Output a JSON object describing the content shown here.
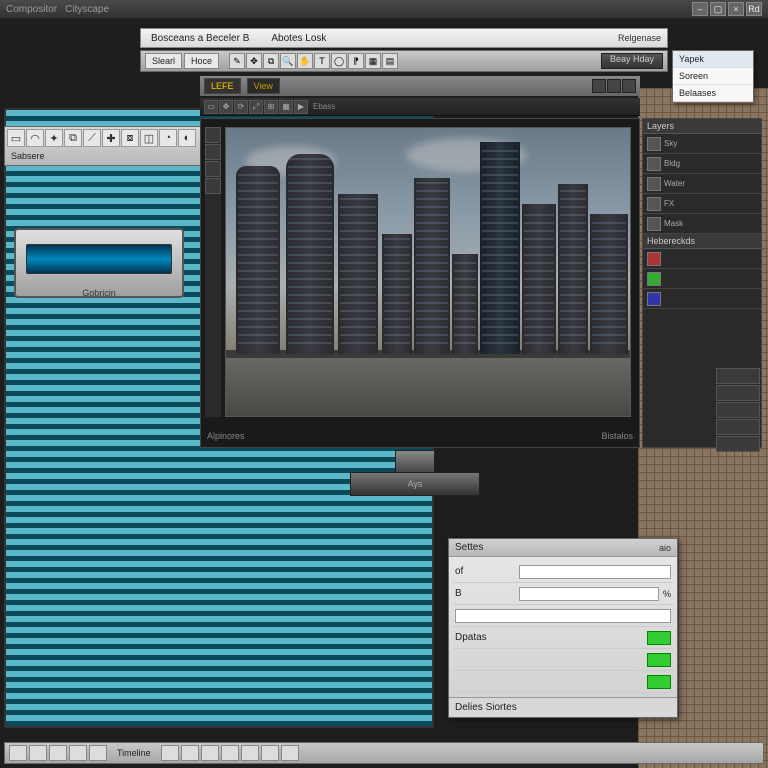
{
  "titlebar": {
    "app": "Compositor",
    "doc": "Cityscape"
  },
  "menu": {
    "item1": "Bosceans a Beceler B",
    "item2": "Abotes Losk",
    "right": "Relgenase"
  },
  "sub": {
    "btn1": "Slearl",
    "btn2": "Hoce",
    "btn_dark": "Beay Hday"
  },
  "dropdown": {
    "i1": "Yapek",
    "i2": "Soreen",
    "i3": "Belaases"
  },
  "tabs": {
    "t1": "LEFE",
    "t2": "View"
  },
  "darkbar": {
    "txt": "Ebass"
  },
  "leftbar": {
    "label": "Sabsere"
  },
  "chrome": {
    "label": "Gobricin"
  },
  "viewport": {
    "statusL": "Alpinores",
    "statusR": "Bistalos"
  },
  "rightpanel": {
    "hdr": "Layers",
    "hdr2": "Hebereckds"
  },
  "stand": {
    "label": "Ays"
  },
  "props": {
    "title": "Settes",
    "title_r": "aio",
    "r1": "of",
    "r2": "B",
    "r3": "Dpatas",
    "footer": "Delies Siortes"
  },
  "bottom": {
    "seg": "Timeline"
  }
}
